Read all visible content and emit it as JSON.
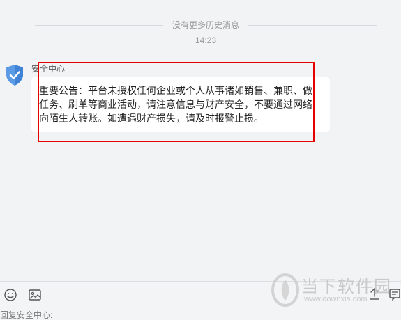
{
  "history": {
    "no_more_label": "没有更多历史消息",
    "time_label": "14:23"
  },
  "message": {
    "sender_name": "安全中心",
    "avatar_icon": "shield-check-icon",
    "body": "重要公告：平台未授权任何企业或个人从事诸如销售、兼职、做任务、刷单等商业活动，请注意信息与财产安全，不要通过网络向陌生人转账。如遭遇财产损失，请及时报警止损。"
  },
  "toolbar": {
    "emoji_icon": "smiley-icon",
    "image_icon": "image-icon",
    "upload_icon": "upload-icon",
    "history_icon": "chat-history-icon"
  },
  "input": {
    "placeholder": "回复安全中心:"
  },
  "watermark": {
    "title": "当下软件园",
    "url": "www.downxia.com"
  },
  "colors": {
    "highlight": "#e60000",
    "shield": "#4a90e2"
  }
}
